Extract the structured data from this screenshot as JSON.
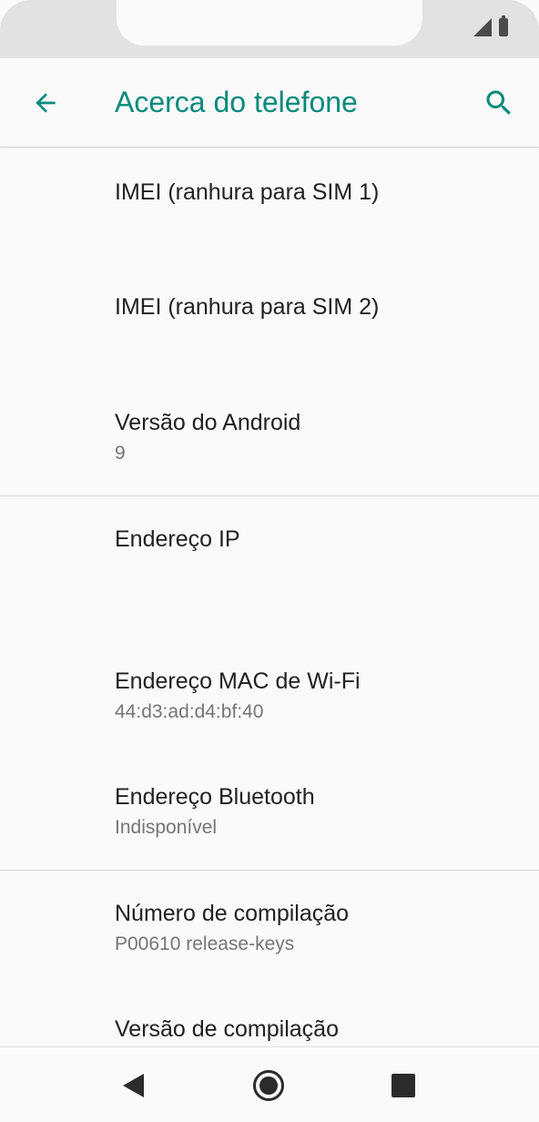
{
  "app_bar": {
    "title": "Acerca do telefone"
  },
  "icons": {
    "back": "arrow-back-icon",
    "search": "search-icon",
    "signal": "signal-icon",
    "battery": "battery-icon",
    "nav_back": "nav-back-icon",
    "nav_home": "nav-home-icon",
    "nav_recents": "nav-recents-icon"
  },
  "colors": {
    "accent": "#00897b",
    "background": "#fafafa",
    "text_primary": "#212121",
    "text_secondary": "#757575"
  },
  "items": [
    {
      "title": "IMEI (ranhura para SIM 1)",
      "summary": ""
    },
    {
      "title": "IMEI (ranhura para SIM 2)",
      "summary": ""
    },
    {
      "title": "Versão do Android",
      "summary": "9"
    },
    {
      "title": "Endereço IP",
      "summary": ""
    },
    {
      "title": "Endereço MAC de Wi-Fi",
      "summary": "44:d3:ad:d4:bf:40"
    },
    {
      "title": "Endereço Bluetooth",
      "summary": "Indisponível"
    },
    {
      "title": "Número de compilação",
      "summary": "P00610 release-keys"
    },
    {
      "title": "Versão de compilação",
      "summary": ""
    }
  ]
}
